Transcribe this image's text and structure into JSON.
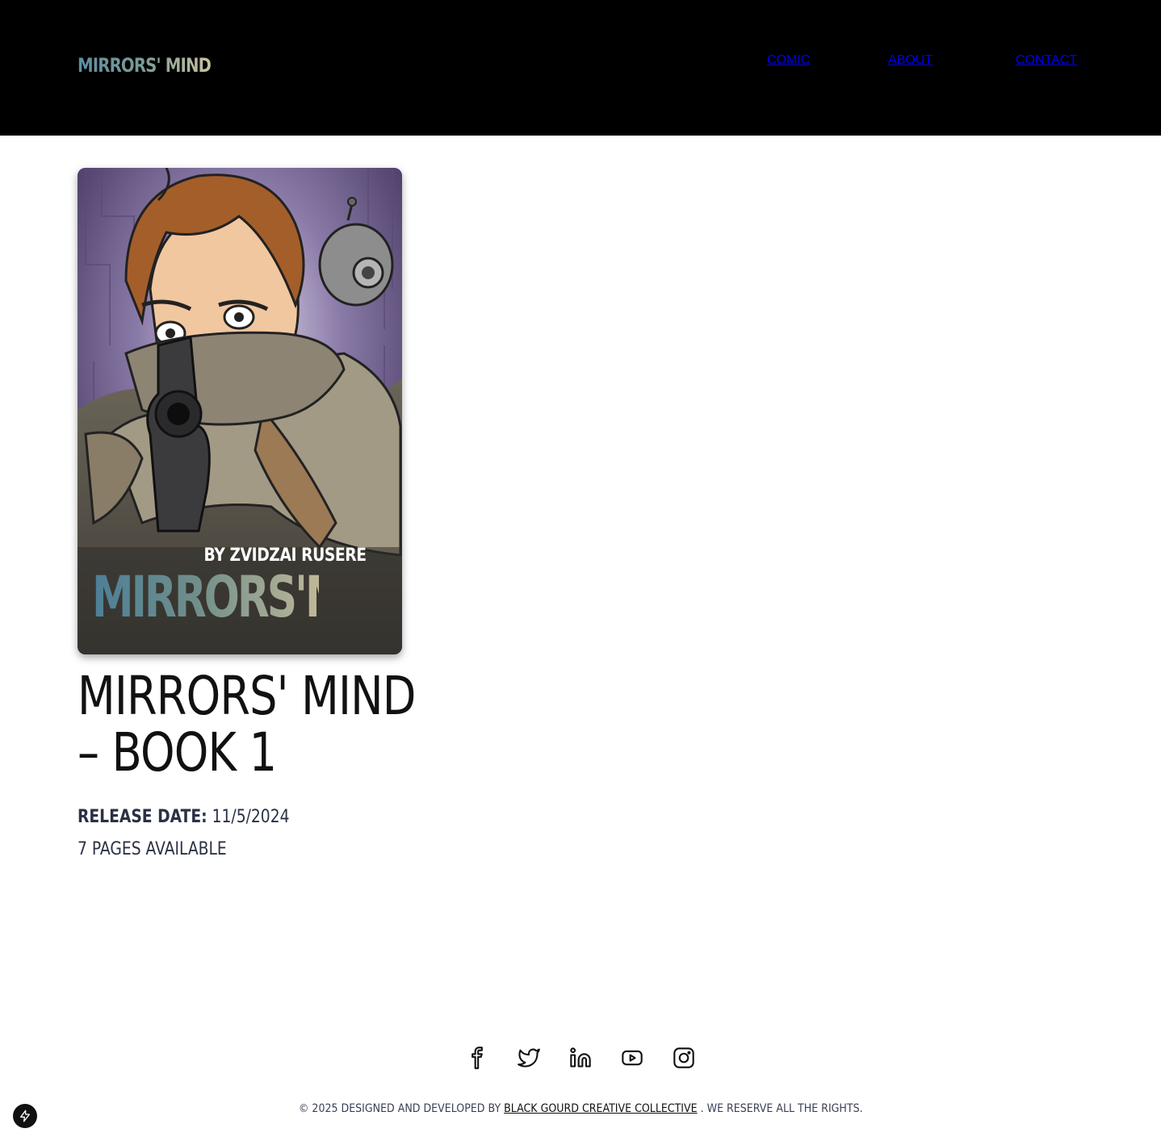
{
  "header": {
    "logo_text": "MIRRORS' MIND",
    "nav": [
      "COMIC",
      "ABOUT",
      "CONTACT"
    ]
  },
  "comic": {
    "cover_byline": "BY ZVIDZAI RUSERE",
    "cover_title": "MIRRORS'MIND",
    "title_line1": "MIRRORS' MIND",
    "title_line2": "– BOOK 1",
    "release_label": "RELEASE DATE:",
    "release_date": "11/5/2024",
    "pages_available": "7 PAGES AVAILABLE"
  },
  "footer": {
    "social_icons": [
      "facebook-icon",
      "twitter-icon",
      "linkedin-icon",
      "youtube-icon",
      "instagram-icon"
    ],
    "copyright_prefix": "© 2025 DESIGNED AND DEVELOPED BY",
    "company_link": "BLACK GOURD CREATIVE COLLECTIVE",
    "copyright_suffix": ". WE RESERVE ALL THE RIGHTS."
  },
  "colors": {
    "header_bg": "#000000",
    "accent_teal": "#5f8da0",
    "accent_sand": "#c9c2a0",
    "meta_text": "#2b3045"
  }
}
